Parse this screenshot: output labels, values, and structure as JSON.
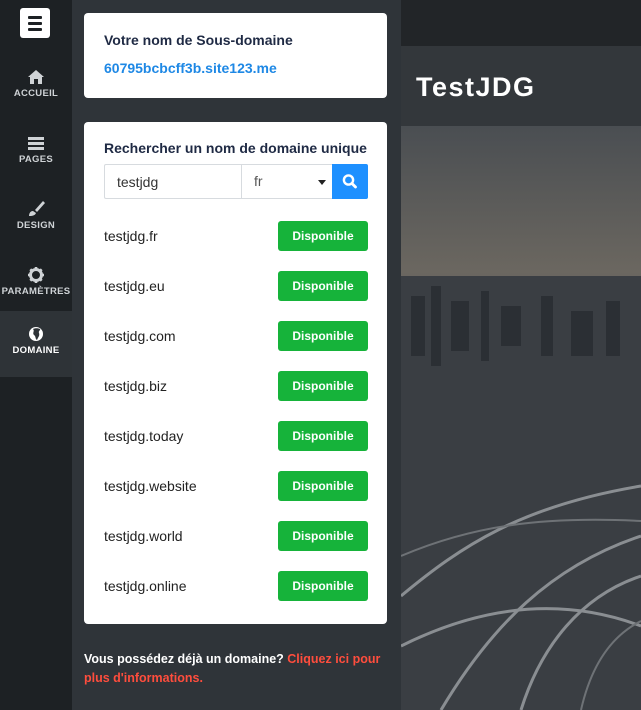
{
  "sidebar": {
    "items": [
      {
        "label": "ACCUEIL",
        "icon": "home-icon"
      },
      {
        "label": "PAGES",
        "icon": "pages-icon"
      },
      {
        "label": "DESIGN",
        "icon": "brush-icon"
      },
      {
        "label": "PARAMÈTRES",
        "icon": "gear-icon"
      },
      {
        "label": "DOMAINE",
        "icon": "globe-icon"
      }
    ],
    "active": "DOMAINE"
  },
  "subdomain": {
    "title": "Votre nom de Sous-domaine",
    "value": "60795bcbcff3b.site123.me"
  },
  "search": {
    "title": "Rechercher un nom de domaine unique",
    "query": "testjdg",
    "tld": "fr"
  },
  "results": [
    {
      "domain": "testjdg.fr",
      "status": "Disponible"
    },
    {
      "domain": "testjdg.eu",
      "status": "Disponible"
    },
    {
      "domain": "testjdg.com",
      "status": "Disponible"
    },
    {
      "domain": "testjdg.biz",
      "status": "Disponible"
    },
    {
      "domain": "testjdg.today",
      "status": "Disponible"
    },
    {
      "domain": "testjdg.website",
      "status": "Disponible"
    },
    {
      "domain": "testjdg.world",
      "status": "Disponible"
    },
    {
      "domain": "testjdg.online",
      "status": "Disponible"
    }
  ],
  "footer": {
    "text": "Vous possédez déjà un domaine? ",
    "link": "Cliquez ici pour plus d'informations."
  },
  "preview": {
    "site_title": "TestJDG"
  },
  "colors": {
    "accent": "#1e88e5",
    "available": "#16b33a",
    "link": "#ff4d3d"
  }
}
